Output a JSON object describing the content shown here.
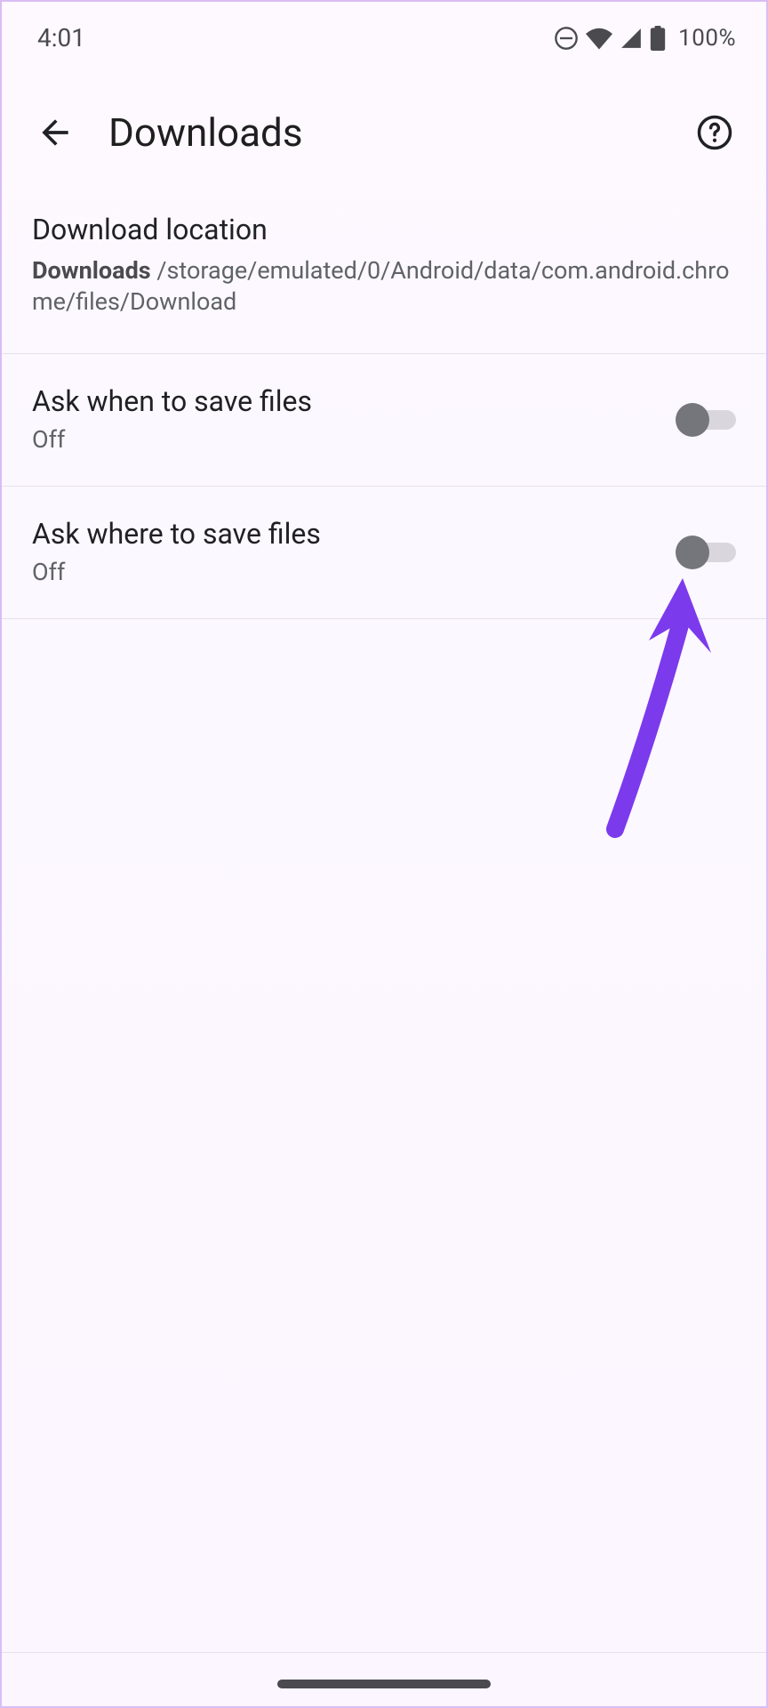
{
  "statusbar": {
    "time": "4:01",
    "battery": "100%"
  },
  "appbar": {
    "title": "Downloads"
  },
  "location": {
    "label": "Download location",
    "folder": "Downloads",
    "path": " /storage/emulated/0/Android/data/com.android.chrome/files/Download"
  },
  "settings": {
    "askWhen": {
      "title": "Ask when to save files",
      "status": "Off"
    },
    "askWhere": {
      "title": "Ask where to save files",
      "status": "Off"
    }
  }
}
